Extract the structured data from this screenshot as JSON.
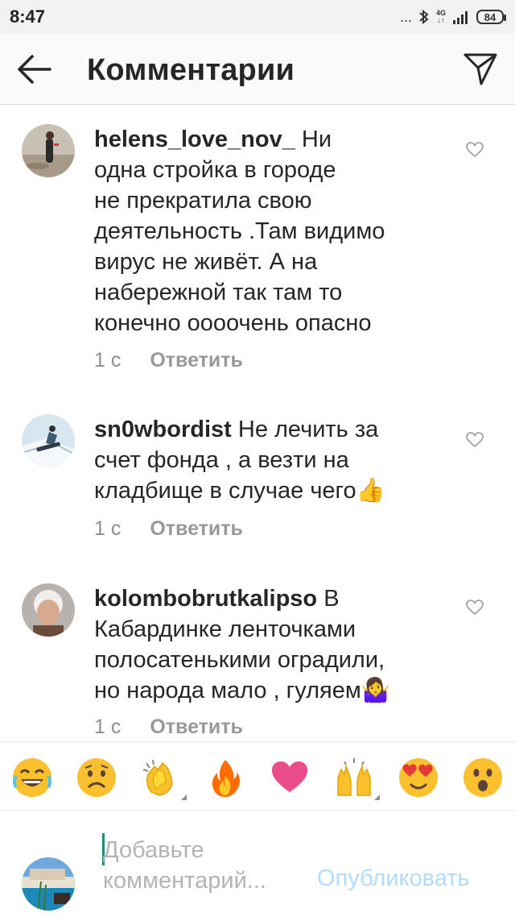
{
  "status_bar": {
    "time": "8:47",
    "dots": "...",
    "network_label_top": "4G",
    "network_label_bottom": "↓↑",
    "battery": "84"
  },
  "header": {
    "title": "Комментарии"
  },
  "comments": [
    {
      "username": "helens_love_nov_",
      "text_lines_first": " Ни",
      "text_lines": [
        "одна стройка в городе",
        "не прекратила свою",
        "деятельность .Там видимо",
        "вирус не живёт.  А на",
        "набережной так там то",
        "конечно оооочень опасно"
      ],
      "time": "1 с",
      "reply": "Ответить"
    },
    {
      "username": "sn0wbordist",
      "text_lines_first": " Не лечить за",
      "text_lines": [
        "счет фонда , а везти на",
        "кладбище в случае чего👍"
      ],
      "time": "1 с",
      "reply": "Ответить"
    },
    {
      "username": "kolombobrutkalipso",
      "text_lines_first": " В",
      "text_lines": [
        "Кабардинке ленточками",
        "полосатенькими оградили,",
        "но народа мало , гуляем🤷‍♀"
      ],
      "time": "1 с",
      "reply": "Ответить"
    }
  ],
  "emoji_bar": [
    {
      "name": "joy",
      "glyph": "😂"
    },
    {
      "name": "sad",
      "glyph": "😢"
    },
    {
      "name": "clap",
      "glyph": "👏"
    },
    {
      "name": "fire",
      "glyph": "🔥"
    },
    {
      "name": "heart",
      "glyph": "❤"
    },
    {
      "name": "raised-hands",
      "glyph": "🙌"
    },
    {
      "name": "heart-eyes",
      "glyph": "😍"
    },
    {
      "name": "surprised",
      "glyph": "😮"
    }
  ],
  "composer": {
    "placeholder_line1": "Добавьте",
    "placeholder_line2": "комментарий...",
    "publish": "Опубликовать"
  },
  "colors": {
    "header_bg": "#fafafa",
    "text": "#262626",
    "muted": "#8e8e8e",
    "publish_disabled": "#b3dbff",
    "caret": "#1a8a7a"
  }
}
